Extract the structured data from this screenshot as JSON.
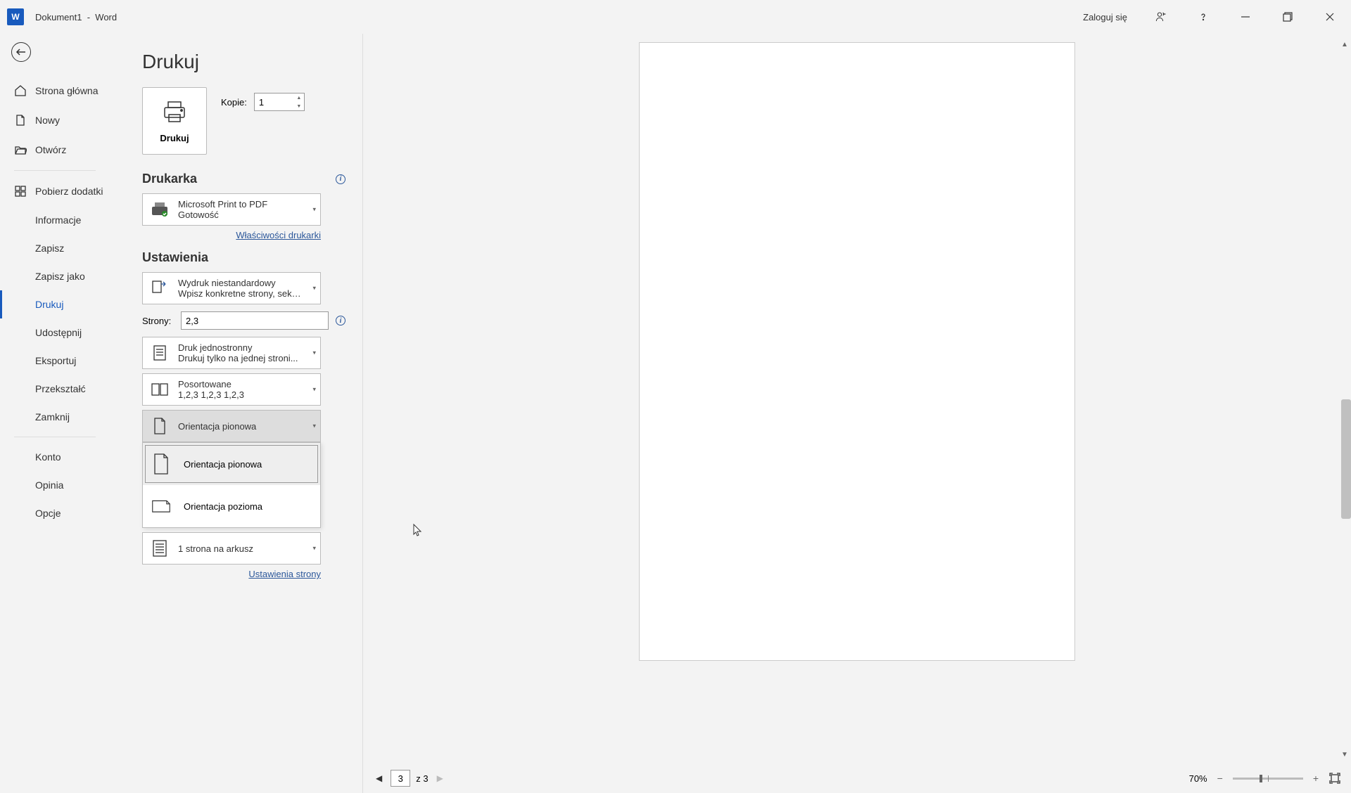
{
  "titlebar": {
    "document": "Dokument1",
    "separator": "-",
    "app": "Word",
    "signin": "Zaloguj się"
  },
  "sidebar": {
    "home": "Strona główna",
    "new": "Nowy",
    "open": "Otwórz",
    "addins": "Pobierz dodatki",
    "info": "Informacje",
    "save": "Zapisz",
    "saveas": "Zapisz jako",
    "print": "Drukuj",
    "share": "Udostępnij",
    "export": "Eksportuj",
    "transform": "Przekształć",
    "close": "Zamknij",
    "account": "Konto",
    "feedback": "Opinia",
    "options": "Opcje"
  },
  "print": {
    "title": "Drukuj",
    "button_label": "Drukuj",
    "copies_label": "Kopie:",
    "copies_value": "1",
    "printer_section": "Drukarka",
    "printer_name": "Microsoft Print to PDF",
    "printer_status": "Gotowość",
    "printer_props": "Właściwości drukarki",
    "settings_section": "Ustawienia",
    "print_what_title": "Wydruk niestandardowy",
    "print_what_sub": "Wpisz konkretne strony, sekcj...",
    "pages_label": "Strony:",
    "pages_value": "2,3",
    "sides_title": "Druk jednostronny",
    "sides_sub": "Drukuj tylko na jednej stroni...",
    "collate_title": "Posortowane",
    "collate_sub": "1,2,3      1,2,3      1,2,3",
    "orientation_title": "Orientacja pionowa",
    "orientation_options": {
      "portrait": "Orientacja pionowa",
      "landscape": "Orientacja pozioma"
    },
    "pages_per_sheet": "1 strona na arkusz",
    "page_setup": "Ustawienia strony"
  },
  "preview": {
    "current_page": "3",
    "total_text": "z 3",
    "zoom": "70%"
  }
}
